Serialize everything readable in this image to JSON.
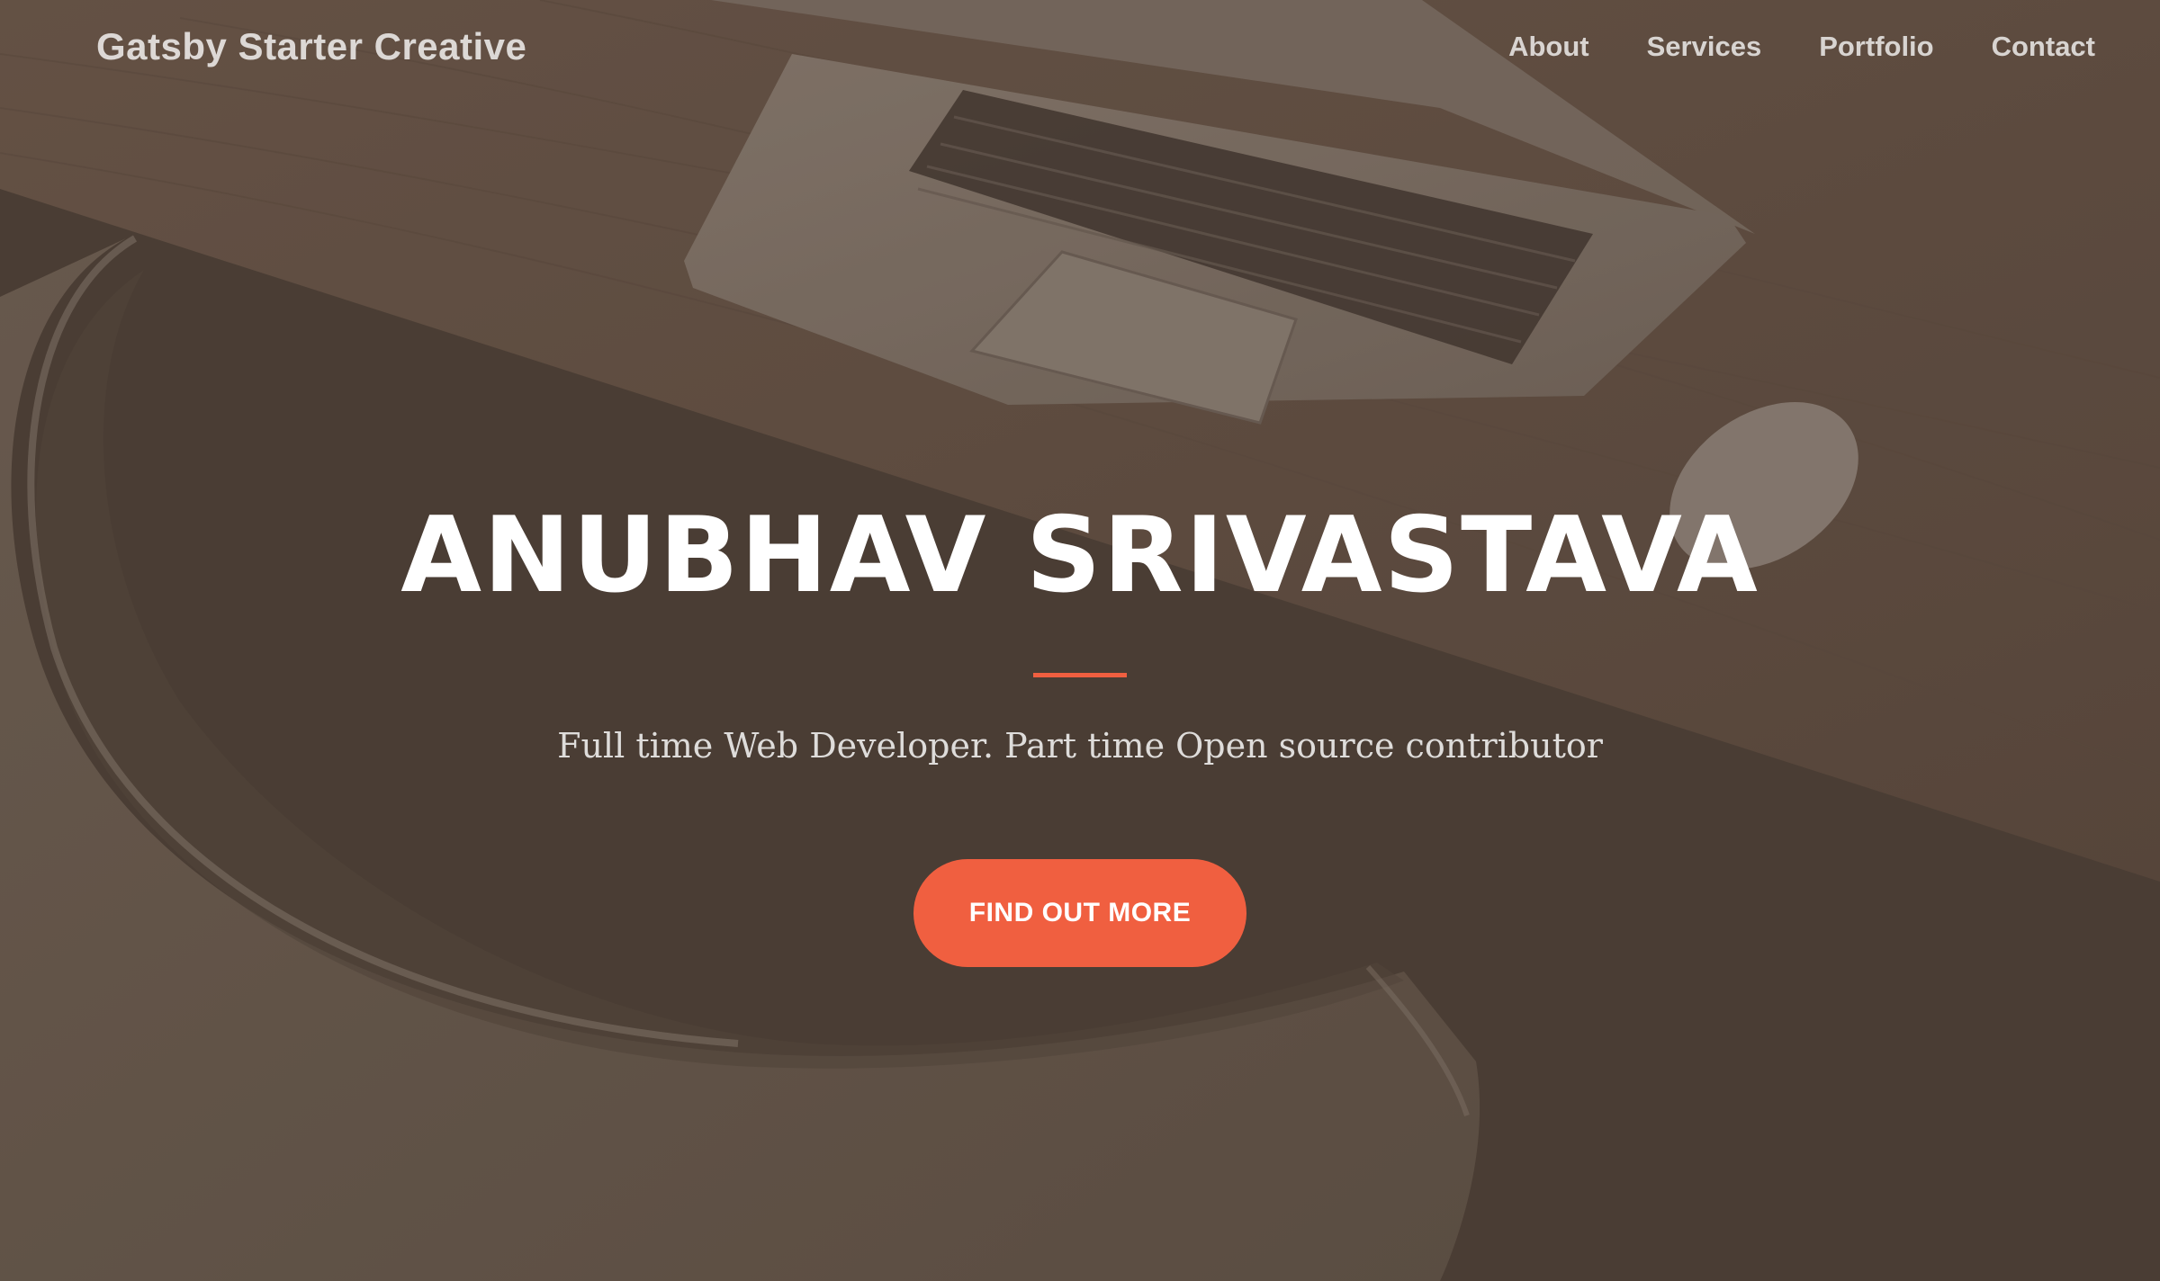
{
  "navbar": {
    "brand": "Gatsby Starter Creative",
    "links": [
      {
        "label": "About"
      },
      {
        "label": "Services"
      },
      {
        "label": "Portfolio"
      },
      {
        "label": "Contact"
      }
    ]
  },
  "hero": {
    "title": "ANUBHAV SRIVASTAVA",
    "subtitle": "Full time Web Developer. Part time Open source contributor",
    "cta_label": "FIND OUT MORE"
  },
  "colors": {
    "accent": "#f05f40",
    "overlay": "#4b3f36"
  }
}
